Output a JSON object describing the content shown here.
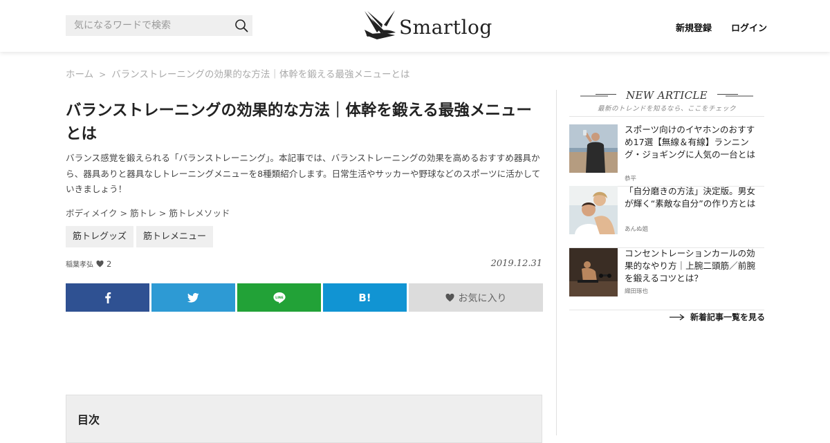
{
  "header": {
    "search_placeholder": "気になるワードで検索",
    "logo_text": "Smartlog",
    "signup_label": "新規登録",
    "login_label": "ログイン"
  },
  "breadcrumb": {
    "home": "ホーム",
    "separator": ">",
    "current": "バランストレーニングの効果的な方法｜体幹を鍛える最強メニューとは"
  },
  "article": {
    "title": "バランストレーニングの効果的な方法｜体幹を鍛える最強メニューとは",
    "description": "バランス感覚を鍛えられる「バランストレーニング」。本記事では、バランストレーニングの効果を高めるおすすめ器具から、器具ありと器具なしトレーニングメニューを8種類紹介します。日常生活やサッカーや野球などのスポーツに活かしていきましょう！",
    "categories": [
      "ボディメイク",
      "筋トレ",
      "筋トレメソッド"
    ],
    "category_separator": ">",
    "tags": [
      "筋トレグッズ",
      "筋トレメニュー"
    ],
    "author": "稲葉孝弘",
    "like_count": "2",
    "date": "2019.12.31",
    "share": {
      "hatena_label": "B!",
      "favorite_label": "お気に入り"
    },
    "toc_title": "目次"
  },
  "sidebar": {
    "heading": "NEW ARTICLE",
    "subheading": "最新のトレンドを知るなら、ここをチェック",
    "articles": [
      {
        "title": "スポーツ向けのイヤホンのおすすめ17選【無線＆有線】ランニング・ジョギングに人気の一台とは",
        "author": "恭平"
      },
      {
        "title": "「自分磨きの方法」決定版。男女が輝く“素敵な自分”の作り方とは",
        "author": "あんぬ姐"
      },
      {
        "title": "コンセントレーションカールの効果的なやり方｜上腕二頭筋／前腕を鍛えるコツとは？",
        "author": "織田琢也"
      }
    ],
    "more_label": "新着記事一覧を見る"
  },
  "colors": {
    "facebook": "#2f5192",
    "twitter": "#2d9ad4",
    "line": "#22a237",
    "hatena": "#1194d3",
    "favorite_bg": "#dcdcdc"
  }
}
